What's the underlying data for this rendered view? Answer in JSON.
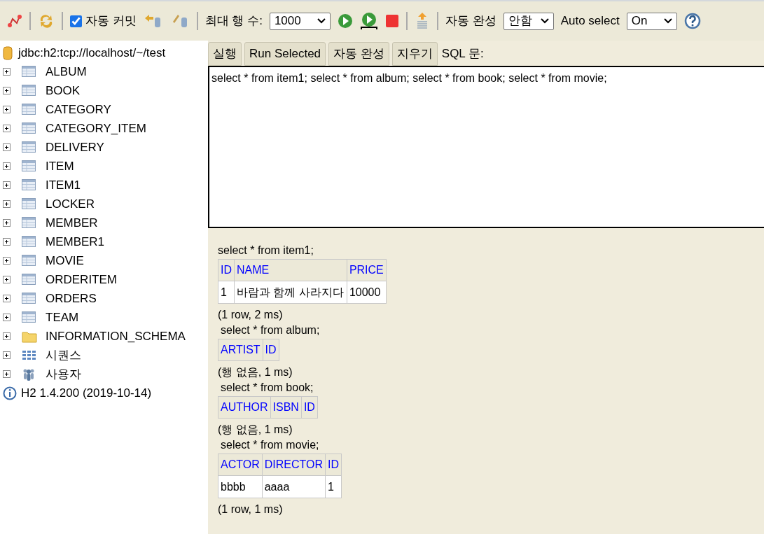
{
  "toolbar": {
    "auto_commit": {
      "label": "자동 커밋",
      "checked": true
    },
    "max_rows": {
      "label": "최대 행 수:",
      "value": "1000"
    },
    "autocomplete": {
      "label": "자동 완성",
      "value": "안함"
    },
    "auto_select": {
      "label": "Auto select",
      "value": "On"
    }
  },
  "tree": {
    "connection": "jdbc:h2:tcp://localhost/~/test",
    "items": [
      {
        "kind": "table",
        "label": "ALBUM"
      },
      {
        "kind": "table",
        "label": "BOOK"
      },
      {
        "kind": "table",
        "label": "CATEGORY"
      },
      {
        "kind": "table",
        "label": "CATEGORY_ITEM"
      },
      {
        "kind": "table",
        "label": "DELIVERY"
      },
      {
        "kind": "table",
        "label": "ITEM"
      },
      {
        "kind": "table",
        "label": "ITEM1"
      },
      {
        "kind": "table",
        "label": "LOCKER"
      },
      {
        "kind": "table",
        "label": "MEMBER"
      },
      {
        "kind": "table",
        "label": "MEMBER1"
      },
      {
        "kind": "table",
        "label": "MOVIE"
      },
      {
        "kind": "table",
        "label": "ORDERITEM"
      },
      {
        "kind": "table",
        "label": "ORDERS"
      },
      {
        "kind": "table",
        "label": "TEAM"
      },
      {
        "kind": "folder",
        "label": "INFORMATION_SCHEMA"
      },
      {
        "kind": "sequence",
        "label": "시퀀스"
      },
      {
        "kind": "users",
        "label": "사용자"
      }
    ],
    "version": "H2 1.4.200 (2019-10-14)"
  },
  "buttons": [
    "실행",
    "Run Selected",
    "자동 완성",
    "지우기"
  ],
  "sql_label": "SQL 문:",
  "editor": {
    "value": "select * from item1; select * from album; select * from book; select * from movie;"
  },
  "results": [
    {
      "query": "select * from item1;",
      "columns": [
        "ID",
        "NAME",
        "PRICE"
      ],
      "rows": [
        [
          "1",
          "바람과 함께 사라지다",
          "10000"
        ]
      ],
      "footer": "(1 row, 2 ms)"
    },
    {
      "query": "select * from album;",
      "columns": [
        "ARTIST",
        "ID"
      ],
      "footer": "(행 없음, 1 ms)"
    },
    {
      "query": "select * from book;",
      "columns": [
        "AUTHOR",
        "ISBN",
        "ID"
      ],
      "footer": "(행 없음, 1 ms)"
    },
    {
      "query": "select * from movie;",
      "columns": [
        "ACTOR",
        "DIRECTOR",
        "ID"
      ],
      "rows": [
        [
          "bbbb",
          "aaaa",
          "1"
        ]
      ],
      "footer": "(1 row, 1 ms)"
    }
  ]
}
